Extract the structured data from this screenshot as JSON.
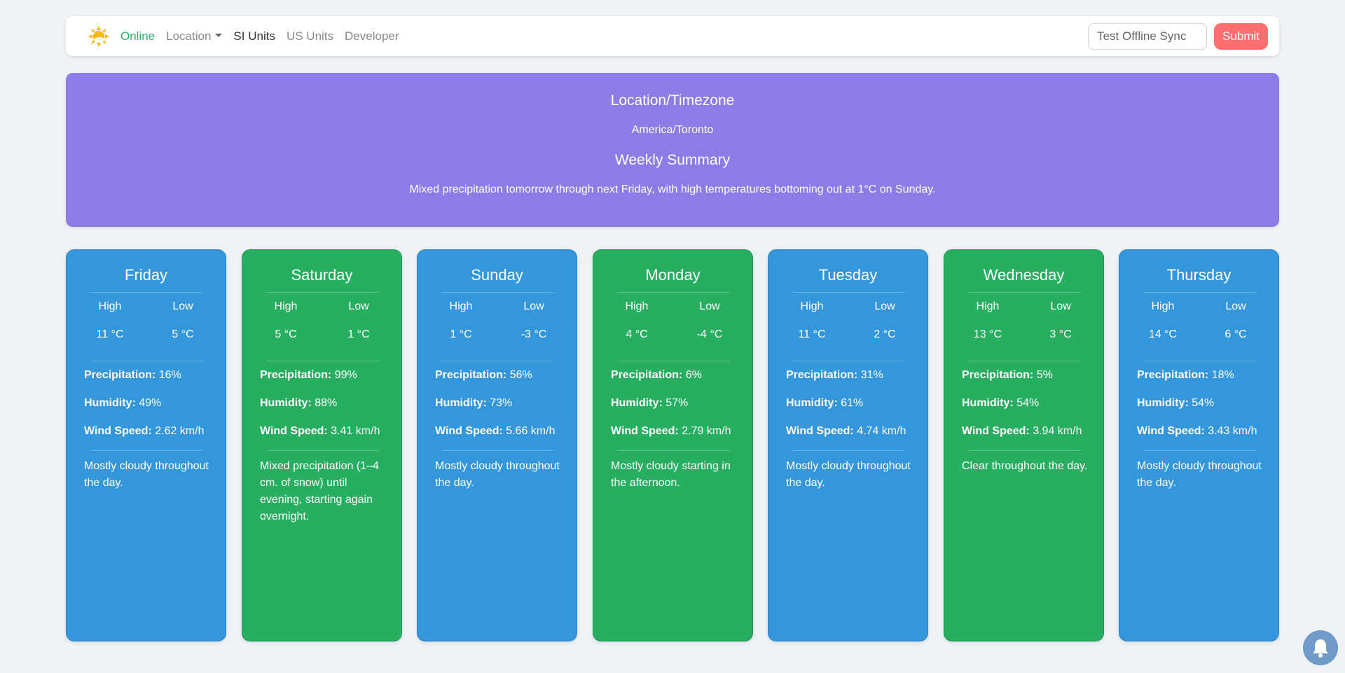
{
  "navbar": {
    "status": "Online",
    "location": "Location",
    "si_units": "SI Units",
    "us_units": "US Units",
    "developer": "Developer",
    "sync_placeholder": "Test Offline Sync",
    "submit": "Submit"
  },
  "summary": {
    "tz_title": "Location/Timezone",
    "tz_value": "America/Toronto",
    "weekly_title": "Weekly Summary",
    "weekly_text": "Mixed precipitation tomorrow through next Friday, with high temperatures bottoming out at 1°C on Sunday."
  },
  "labels": {
    "high": "High",
    "low": "Low",
    "precipitation": "Precipitation:",
    "humidity": "Humidity:",
    "wind": "Wind Speed:"
  },
  "colors": {
    "blue": "#3597db",
    "green": "#27ae60",
    "banner": "#8c7ce6",
    "submit": "#ff6f6f"
  },
  "days": [
    {
      "name": "Friday",
      "high": "11 °C",
      "low": "5 °C",
      "precip": "16%",
      "humidity": "49%",
      "wind": "2.62 km/h",
      "desc": "Mostly cloudy throughout the day."
    },
    {
      "name": "Saturday",
      "high": "5 °C",
      "low": "1 °C",
      "precip": "99%",
      "humidity": "88%",
      "wind": "3.41 km/h",
      "desc": "Mixed precipitation (1–4 cm. of snow) until evening, starting again overnight."
    },
    {
      "name": "Sunday",
      "high": "1 °C",
      "low": "-3 °C",
      "precip": "56%",
      "humidity": "73%",
      "wind": "5.66 km/h",
      "desc": "Mostly cloudy throughout the day."
    },
    {
      "name": "Monday",
      "high": "4 °C",
      "low": "-4 °C",
      "precip": "6%",
      "humidity": "57%",
      "wind": "2.79 km/h",
      "desc": "Mostly cloudy starting in the afternoon."
    },
    {
      "name": "Tuesday",
      "high": "11 °C",
      "low": "2 °C",
      "precip": "31%",
      "humidity": "61%",
      "wind": "4.74 km/h",
      "desc": "Mostly cloudy throughout the day."
    },
    {
      "name": "Wednesday",
      "high": "13 °C",
      "low": "3 °C",
      "precip": "5%",
      "humidity": "54%",
      "wind": "3.94 km/h",
      "desc": "Clear throughout the day."
    },
    {
      "name": "Thursday",
      "high": "14 °C",
      "low": "6 °C",
      "precip": "18%",
      "humidity": "54%",
      "wind": "3.43 km/h",
      "desc": "Mostly cloudy throughout the day."
    }
  ]
}
